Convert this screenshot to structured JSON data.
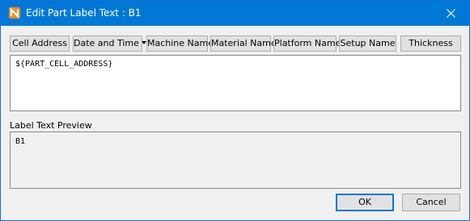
{
  "window": {
    "title": "Edit Part Label Text : B1",
    "accent_color": "#0078d7",
    "app_icon": "app-logo-icon",
    "close_icon": "close-icon"
  },
  "toolbar": {
    "buttons": [
      {
        "label": "Cell Address"
      },
      {
        "label": "Date and Time",
        "has_dropdown": true
      },
      {
        "label": "Machine Name"
      },
      {
        "label": "Material Name"
      },
      {
        "label": "Platform Name"
      },
      {
        "label": "Setup Name"
      },
      {
        "label": "Thickness"
      }
    ]
  },
  "editor": {
    "value": "${PART_CELL_ADDRESS}"
  },
  "preview": {
    "label": "Label Text Preview",
    "value": "B1"
  },
  "actions": {
    "ok_label": "OK",
    "cancel_label": "Cancel"
  }
}
